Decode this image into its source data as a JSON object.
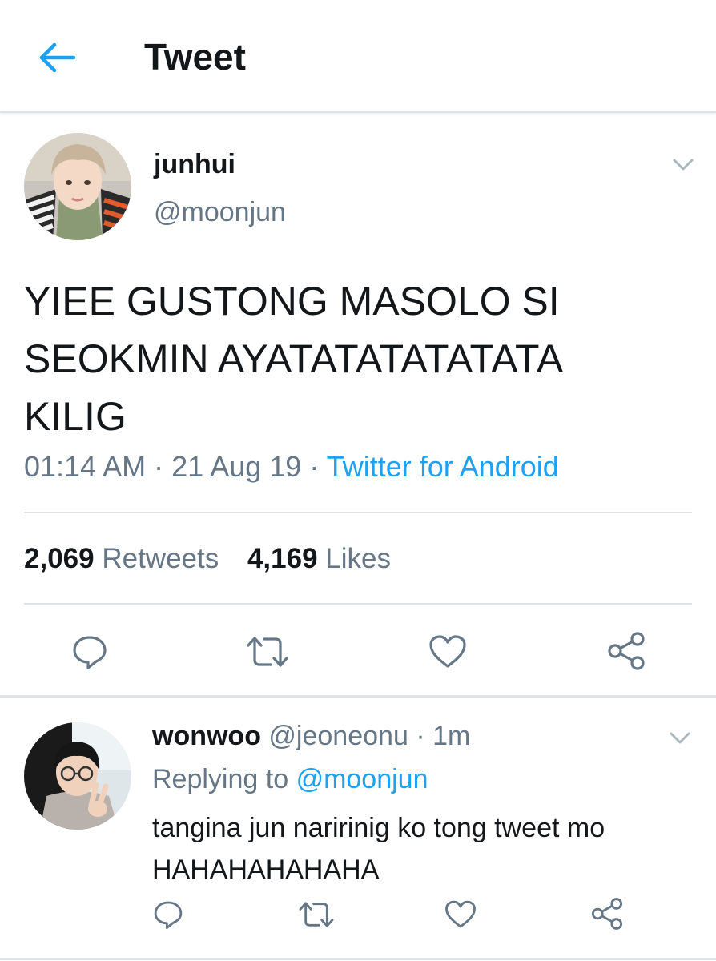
{
  "header": {
    "title": "Tweet",
    "back_icon": "arrow-left-icon",
    "accent": "#1da1f2"
  },
  "tweet": {
    "author_name": "junhui",
    "author_handle": "@moonjun",
    "text": "YIEE GUSTONG MASOLO SI\nSEOKMIN AYATATATATATATA\nKILIG",
    "time": "01:14 AM",
    "date": "21 Aug 19",
    "dot": "·",
    "source": "Twitter for Android",
    "retweets_count": "2,069",
    "retweets_label": "Retweets",
    "likes_count": "4,169",
    "likes_label": "Likes",
    "actions": [
      "reply-icon",
      "retweet-icon",
      "like-icon",
      "share-icon"
    ]
  },
  "reply": {
    "author_name": "wonwoo",
    "author_handle": "@jeoneonu",
    "dot": "·",
    "age": "1m",
    "replying_prefix": "Replying to",
    "replying_to": "@moonjun",
    "text": "tangina jun naririnig ko tong tweet mo HAHAHAHAHAHA",
    "actions": [
      "reply-icon",
      "retweet-icon",
      "like-icon",
      "share-icon"
    ]
  }
}
